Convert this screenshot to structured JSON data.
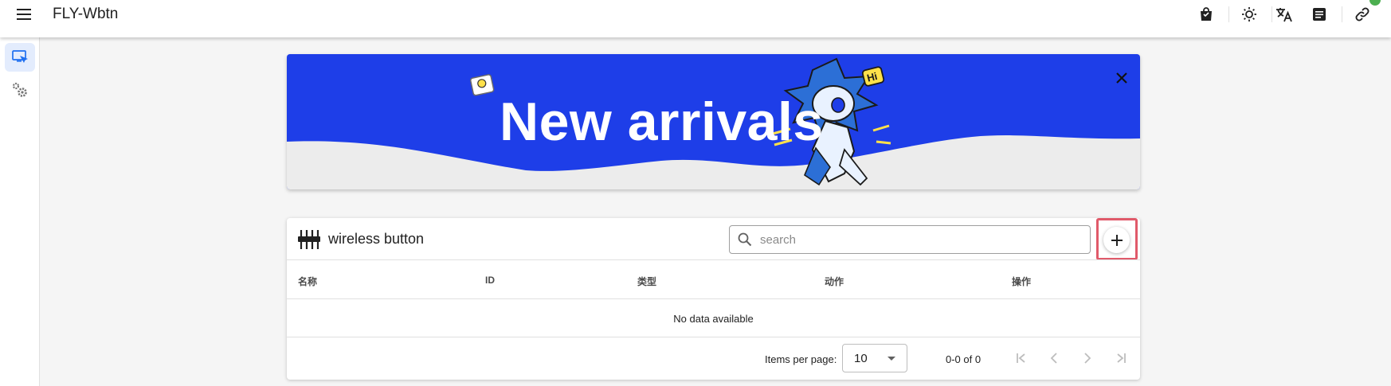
{
  "app": {
    "title": "FLY-Wbtn"
  },
  "topbar": {
    "icons": [
      "shopping-bag-icon",
      "theme-icon",
      "translate-icon",
      "document-icon",
      "link-icon"
    ],
    "status_color": "#4caf50"
  },
  "rail": {
    "items": [
      "devices-icon",
      "settings-icon"
    ],
    "active": 0
  },
  "banner": {
    "title": "New arrivals",
    "badge": "Hi",
    "color": "#1e3ee8"
  },
  "card": {
    "title": "wireless button",
    "search_placeholder": "search",
    "add_label": "+",
    "columns": [
      "名称",
      "ID",
      "类型",
      "动作",
      "操作"
    ],
    "empty_text": "No data available",
    "items_per_page_label": "Items per page:",
    "items_per_page": "10",
    "range_text": "0-0 of 0"
  }
}
